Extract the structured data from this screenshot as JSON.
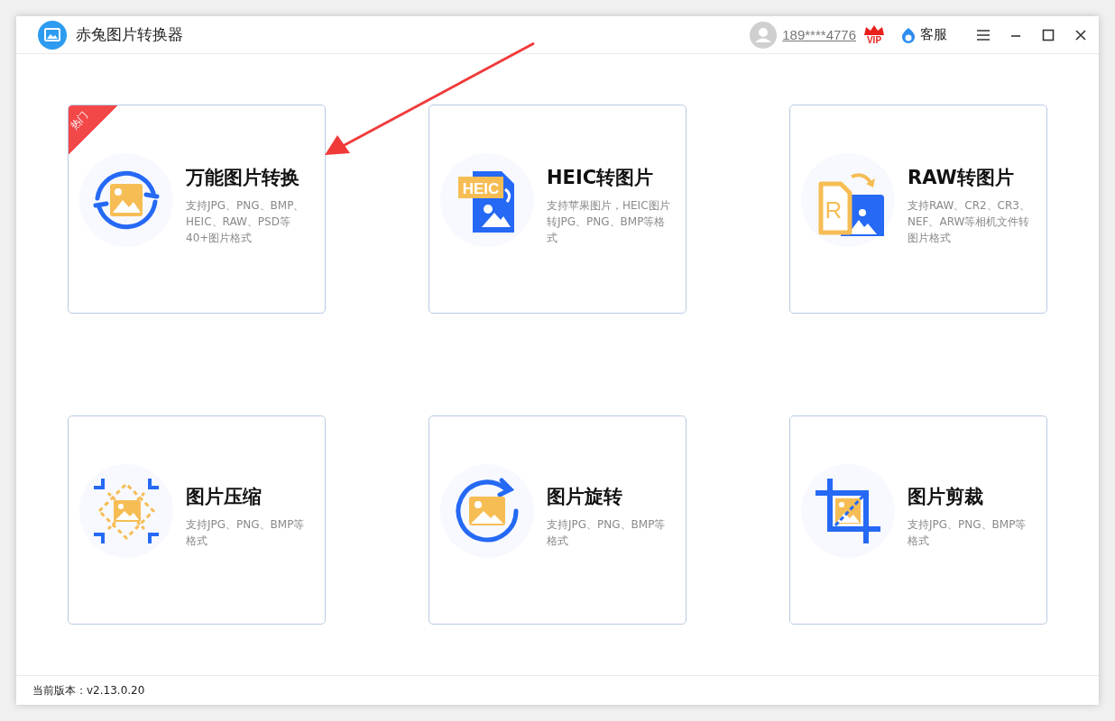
{
  "window": {
    "title": "赤兔图片转换器"
  },
  "header": {
    "phone": "189****4776",
    "vip_label": "VIP",
    "service": "客服"
  },
  "cards": [
    {
      "kind": "convert",
      "title": "万能图片转换",
      "description": "支持JPG、PNG、BMP、HEIC、RAW、PSD等40+图片格式",
      "badge": "热门"
    },
    {
      "kind": "heic",
      "title": "HEIC转图片",
      "description": "支持苹果图片，HEIC图片转JPG、PNG、BMP等格式",
      "icon_label": "HEIC"
    },
    {
      "kind": "raw",
      "title": "RAW转图片",
      "description": "支持RAW、CR2、CR3、NEF、ARW等相机文件转图片格式",
      "icon_label": "R"
    },
    {
      "kind": "compress",
      "title": "图片压缩",
      "description": "支持JPG、PNG、BMP等格式"
    },
    {
      "kind": "rotate",
      "title": "图片旋转",
      "description": "支持JPG、PNG、BMP等格式"
    },
    {
      "kind": "crop",
      "title": "图片剪裁",
      "description": "支持JPG、PNG、BMP等格式"
    }
  ],
  "status_bar": {
    "version": "当前版本：v2.13.0.20"
  }
}
